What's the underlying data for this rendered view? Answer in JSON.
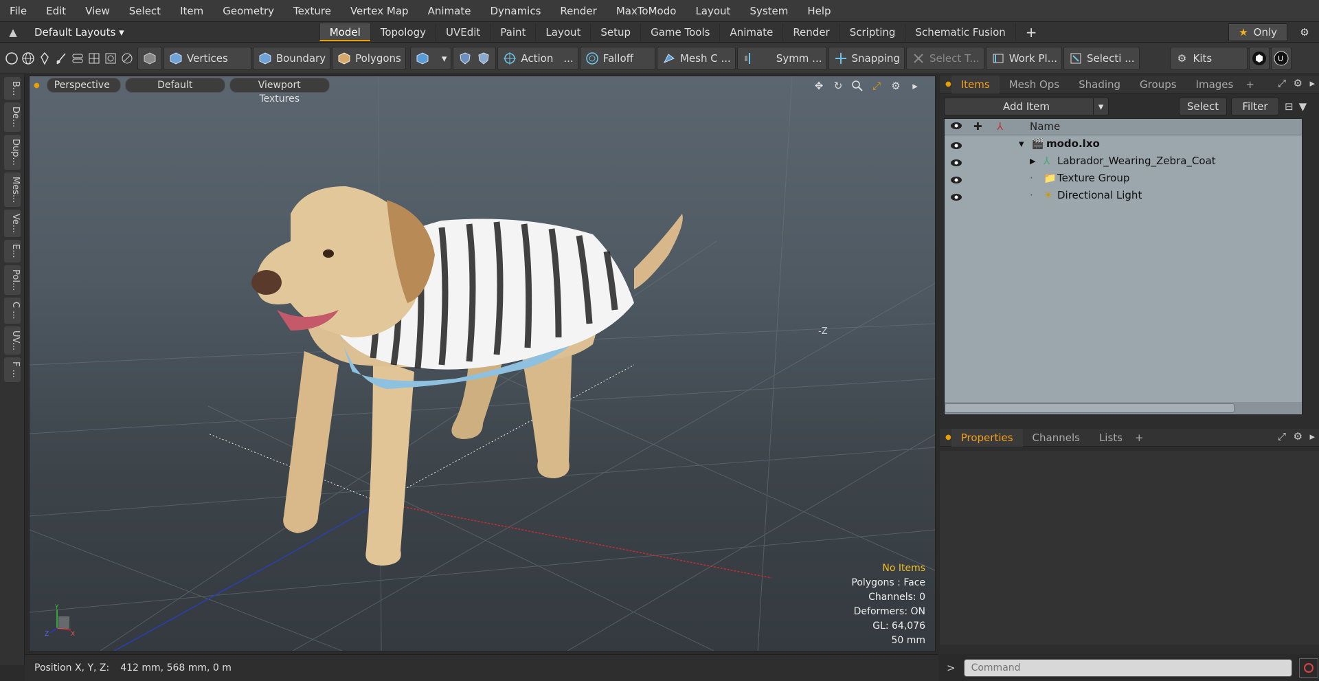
{
  "menu": [
    "File",
    "Edit",
    "View",
    "Select",
    "Item",
    "Geometry",
    "Texture",
    "Vertex Map",
    "Animate",
    "Dynamics",
    "Render",
    "MaxToModo",
    "Layout",
    "System",
    "Help"
  ],
  "layout_bar": {
    "layouts_label": "Default Layouts",
    "tabs": [
      "Model",
      "Topology",
      "UVEdit",
      "Paint",
      "Layout",
      "Setup",
      "Game Tools",
      "Animate",
      "Render",
      "Scripting",
      "Schematic Fusion"
    ],
    "active_tab": "Model",
    "only_label": "Only"
  },
  "toolbar": {
    "vertices": "Vertices",
    "boundary": "Boundary",
    "polygons": "Polygons",
    "action": "Action",
    "action_more": "...",
    "falloff": "Falloff",
    "mesh": "Mesh C ...",
    "symm": "Symm ...",
    "snapping": "Snapping",
    "select_t": "Select T...",
    "work_pl": "Work Pl...",
    "selecti": "Selecti ...",
    "kits": "Kits"
  },
  "left_tabs": [
    "B...",
    "De...",
    "Dup...",
    "Mes...",
    "Ve...",
    "E...",
    "Pol...",
    "C ...",
    "UV...",
    "F ..."
  ],
  "viewport": {
    "perspective": "Perspective",
    "default": "Default",
    "viewport_textures": "Viewport Textures",
    "axis_label": "-Z",
    "hud": {
      "no_items": "No Items",
      "polygons": "Polygons : Face",
      "channels": "Channels: 0",
      "deformers": "Deformers: ON",
      "gl": "GL: 64,076",
      "size": "50 mm"
    }
  },
  "status": {
    "position_label": "Position X, Y, Z:",
    "position_value": "412 mm, 568 mm, 0 m"
  },
  "items_panel": {
    "tabs": [
      "Items",
      "Mesh Ops",
      "Shading",
      "Groups",
      "Images"
    ],
    "active_tab": "Items",
    "add_item": "Add Item",
    "select": "Select",
    "filter": "Filter",
    "name_header": "Name",
    "rows": [
      {
        "label": "modo.lxo",
        "bold": true,
        "indent": 0
      },
      {
        "label": "Labrador_Wearing_Zebra_Coat",
        "bold": false,
        "indent": 1
      },
      {
        "label": "Texture Group",
        "bold": false,
        "indent": 1
      },
      {
        "label": "Directional Light",
        "bold": false,
        "indent": 1
      }
    ]
  },
  "props_panel": {
    "tabs": [
      "Properties",
      "Channels",
      "Lists"
    ],
    "active_tab": "Properties"
  },
  "command": {
    "prompt": ">",
    "placeholder": "Command"
  },
  "colors": {
    "accent": "#e8a000",
    "items_bg": "#9ca6ad"
  }
}
